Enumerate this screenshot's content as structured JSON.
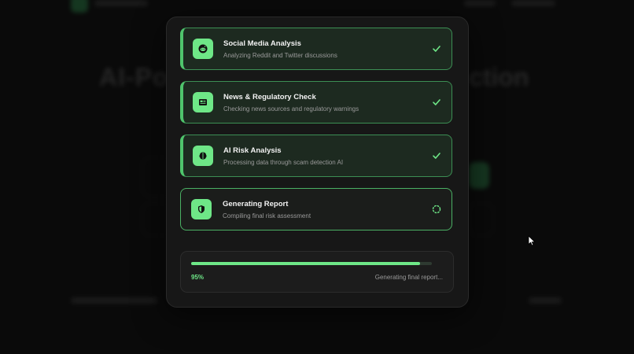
{
  "background": {
    "hero_left": "AI-Po",
    "hero_right": "ction"
  },
  "steps": [
    {
      "title": "Social Media Analysis",
      "subtitle": "Analyzing Reddit and Twitter discussions",
      "icon": "reddit-icon",
      "status": "done"
    },
    {
      "title": "News & Regulatory Check",
      "subtitle": "Checking news sources and regulatory warnings",
      "icon": "newspaper-icon",
      "status": "done"
    },
    {
      "title": "AI Risk Analysis",
      "subtitle": "Processing data through scam detection AI",
      "icon": "brain-icon",
      "status": "done"
    },
    {
      "title": "Generating Report",
      "subtitle": "Compiling final risk assessment",
      "icon": "shield-icon",
      "status": "in-progress"
    }
  ],
  "progress": {
    "value": 95,
    "label": "95%",
    "message": "Generating final report..."
  },
  "colors": {
    "accent": "#6ee787",
    "done_border": "#3c8f54",
    "modal_bg": "#171717",
    "page_bg": "#0a0a0a"
  }
}
